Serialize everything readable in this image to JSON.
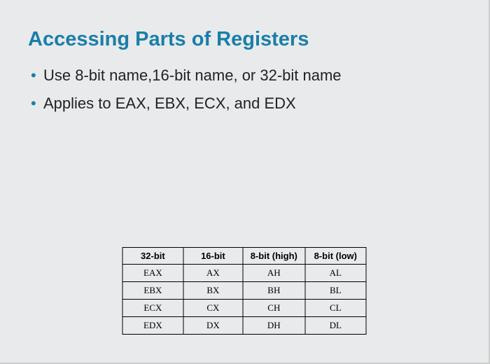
{
  "title": "Accessing Parts of Registers",
  "bullets": [
    "Use 8-bit name,16-bit name, or 32-bit name",
    "Applies to EAX, EBX, ECX, and EDX"
  ],
  "table": {
    "headers": [
      "32-bit",
      "16-bit",
      "8-bit (high)",
      "8-bit (low)"
    ],
    "rows": [
      [
        "EAX",
        "AX",
        "AH",
        "AL"
      ],
      [
        "EBX",
        "BX",
        "BH",
        "BL"
      ],
      [
        "ECX",
        "CX",
        "CH",
        "CL"
      ],
      [
        "EDX",
        "DX",
        "DH",
        "DL"
      ]
    ]
  },
  "chart_data": {
    "type": "table",
    "title": "Accessing Parts of Registers",
    "columns": [
      "32-bit",
      "16-bit",
      "8-bit (high)",
      "8-bit (low)"
    ],
    "rows": [
      {
        "32-bit": "EAX",
        "16-bit": "AX",
        "8-bit (high)": "AH",
        "8-bit (low)": "AL"
      },
      {
        "32-bit": "EBX",
        "16-bit": "BX",
        "8-bit (high)": "BH",
        "8-bit (low)": "BL"
      },
      {
        "32-bit": "ECX",
        "16-bit": "CX",
        "8-bit (high)": "CH",
        "8-bit (low)": "CL"
      },
      {
        "32-bit": "EDX",
        "16-bit": "DX",
        "8-bit (high)": "DH",
        "8-bit (low)": "DL"
      }
    ]
  }
}
